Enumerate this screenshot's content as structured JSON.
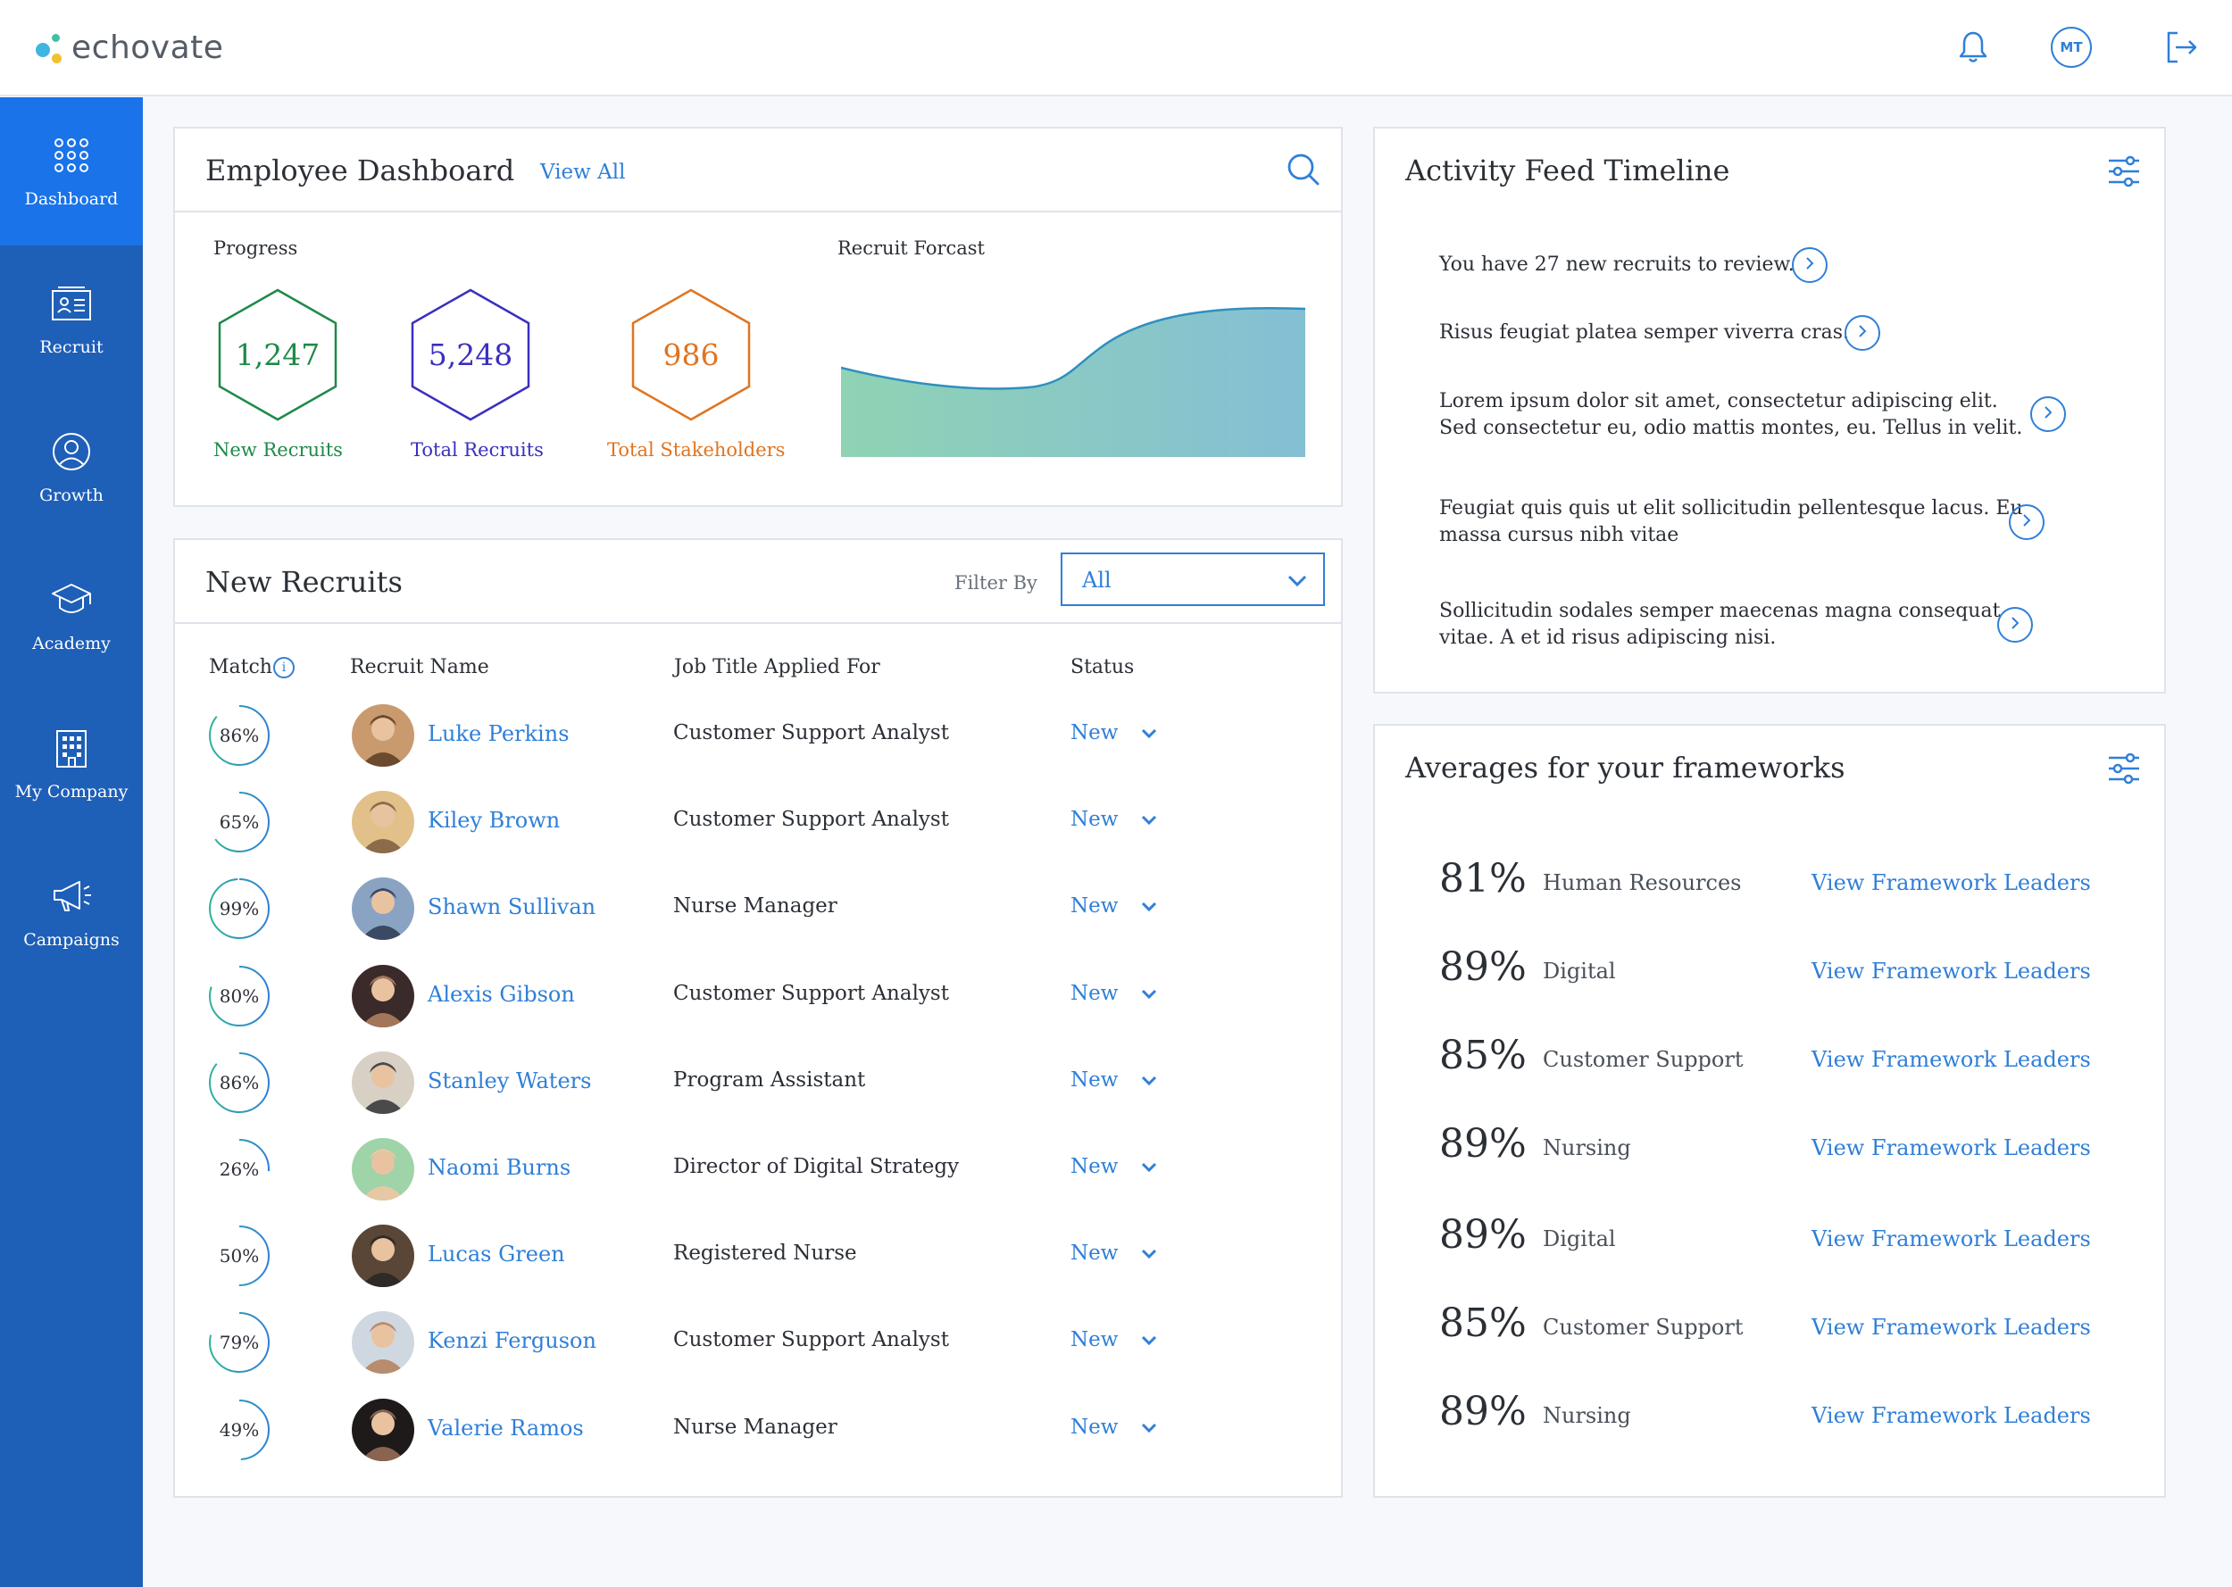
{
  "app": {
    "logo_text": "echovate",
    "user_initials": "MT"
  },
  "colors": {
    "accent": "#2f7fd8",
    "sidebar": "#1e5fb8",
    "sidebar_active": "#1a73e8",
    "green": "#1e8a48",
    "indigo": "#3a2fbf",
    "orange": "#e0741f"
  },
  "sidebar": {
    "items": [
      {
        "label": "Dashboard",
        "icon": "grid-dots-icon",
        "active": true
      },
      {
        "label": "Recruit",
        "icon": "id-card-icon",
        "active": false
      },
      {
        "label": "Growth",
        "icon": "user-icon",
        "active": false
      },
      {
        "label": "Academy",
        "icon": "graduation-cap-icon",
        "active": false
      },
      {
        "label": "My Company",
        "icon": "building-icon",
        "active": false
      },
      {
        "label": "Campaigns",
        "icon": "megaphone-icon",
        "active": false
      }
    ]
  },
  "dashboard": {
    "title": "Employee Dashboard",
    "view_all": "View All",
    "progress_title": "Progress",
    "forecast_title": "Recruit Forcast",
    "stats": [
      {
        "value": "1,247",
        "label": "New Recruits",
        "color": "#1e8a48"
      },
      {
        "value": "5,248",
        "label": "Total Recruits",
        "color": "#3a2fbf"
      },
      {
        "value": "986",
        "label": "Total Stakeholders",
        "color": "#e0741f"
      }
    ]
  },
  "recruits": {
    "title": "New Recruits",
    "filter_label": "Filter By",
    "filter_value": "All",
    "headers": {
      "match": "Match",
      "name": "Recruit Name",
      "job": "Job Title Applied For",
      "status": "Status"
    },
    "rows": [
      {
        "match": "86%",
        "match_value": 0.86,
        "name": "Luke Perkins",
        "job": "Customer Support Analyst",
        "status": "New"
      },
      {
        "match": "65%",
        "match_value": 0.65,
        "name": "Kiley Brown",
        "job": "Customer Support Analyst",
        "status": "New"
      },
      {
        "match": "99%",
        "match_value": 0.99,
        "name": "Shawn Sullivan",
        "job": "Nurse Manager",
        "status": "New"
      },
      {
        "match": "80%",
        "match_value": 0.8,
        "name": "Alexis Gibson",
        "job": "Customer Support Analyst",
        "status": "New"
      },
      {
        "match": "86%",
        "match_value": 0.86,
        "name": "Stanley Waters",
        "job": "Program Assistant",
        "status": "New"
      },
      {
        "match": "26%",
        "match_value": 0.26,
        "name": "Naomi Burns",
        "job": "Director of Digital Strategy",
        "status": "New"
      },
      {
        "match": "50%",
        "match_value": 0.5,
        "name": "Lucas Green",
        "job": "Registered Nurse",
        "status": "New"
      },
      {
        "match": "79%",
        "match_value": 0.79,
        "name": "Kenzi Ferguson",
        "job": "Customer Support Analyst",
        "status": "New"
      },
      {
        "match": "49%",
        "match_value": 0.49,
        "name": "Valerie Ramos",
        "job": "Nurse Manager",
        "status": "New"
      }
    ]
  },
  "activity": {
    "title": "Activity Feed Timeline",
    "items": [
      {
        "text": "You have 27 new recruits to review."
      },
      {
        "text": "Risus feugiat platea semper viverra cras."
      },
      {
        "text": "Lorem ipsum dolor sit amet, consectetur adipiscing elit. Sed consectetur eu, odio mattis montes, eu. Tellus in velit."
      },
      {
        "text": "Feugiat quis quis ut elit sollicitudin pellentesque lacus. Eu massa cursus nibh vitae"
      },
      {
        "text": "Sollicitudin sodales semper maecenas magna consequat vitae. A et id risus adipiscing nisi."
      }
    ]
  },
  "averages": {
    "title": "Averages for your frameworks",
    "link_label": "View Framework Leaders",
    "rows": [
      {
        "pct": "81%",
        "name": "Human Resources"
      },
      {
        "pct": "89%",
        "name": "Digital"
      },
      {
        "pct": "85%",
        "name": "Customer Support"
      },
      {
        "pct": "89%",
        "name": "Nursing"
      },
      {
        "pct": "89%",
        "name": "Digital"
      },
      {
        "pct": "85%",
        "name": "Customer Support"
      },
      {
        "pct": "89%",
        "name": "Nursing"
      }
    ]
  }
}
